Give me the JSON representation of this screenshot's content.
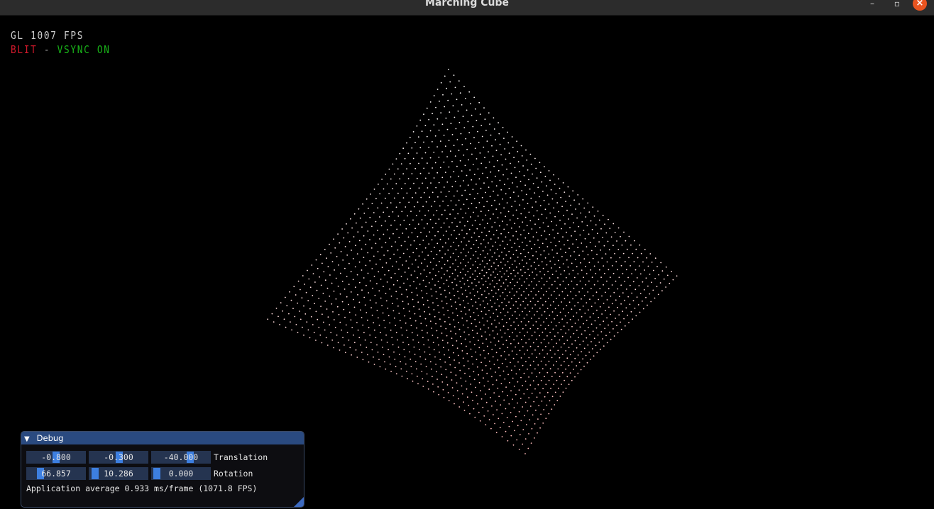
{
  "window": {
    "title": "Marching Cube",
    "controls": {
      "minimize": "–",
      "maximize": "▫",
      "close": "×"
    }
  },
  "overlay": {
    "fps_text": "GL 1007 FPS",
    "blit_text": "BLIT",
    "separator": "-",
    "vsync_text": "VSYNC ON",
    "colors": {
      "fps": "#cfcfcf",
      "blit": "#d0192b",
      "vsync": "#19b419"
    }
  },
  "debug": {
    "title": "Debug",
    "translation": {
      "label": "Translation",
      "values": [
        "-0.800",
        "-0.300",
        "-40.000"
      ]
    },
    "rotation": {
      "label": "Rotation",
      "values": [
        "66.857",
        "10.286",
        "0.000"
      ]
    },
    "average_text": "Application average 0.933 ms/frame (1071.8 FPS)",
    "colors": {
      "title_bg": "#2a4a80",
      "field_bg": "#253450",
      "grab": "#3d7fe0"
    }
  }
}
